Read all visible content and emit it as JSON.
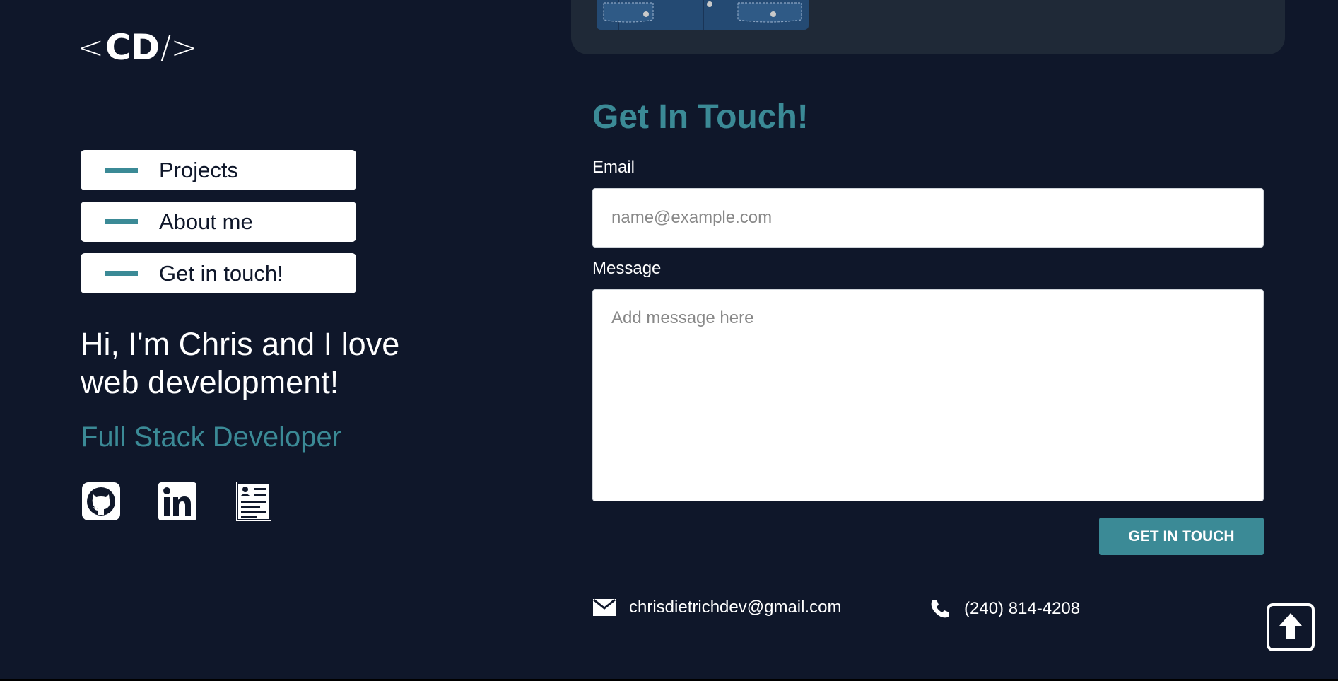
{
  "logo": {
    "open": "<",
    "text": "CD",
    "close": "/>"
  },
  "nav": {
    "items": [
      {
        "label": "Projects"
      },
      {
        "label": "About me"
      },
      {
        "label": "Get in touch!"
      }
    ]
  },
  "hero": {
    "headline": "Hi, I'm Chris and I love web development!",
    "role": "Full Stack Developer"
  },
  "socials": [
    {
      "icon": "github-icon"
    },
    {
      "icon": "linkedin-icon"
    },
    {
      "icon": "resume-icon"
    }
  ],
  "contact": {
    "title": "Get In Touch!",
    "email_label": "Email",
    "email_placeholder": "name@example.com",
    "message_label": "Message",
    "message_placeholder": "Add message here",
    "submit_label": "GET IN TOUCH",
    "email": "chrisdietrichdev@gmail.com",
    "phone": "(240) 814-4208"
  },
  "colors": {
    "background": "#0f172a",
    "accent": "#3b8a96",
    "card": "#1f2937"
  }
}
